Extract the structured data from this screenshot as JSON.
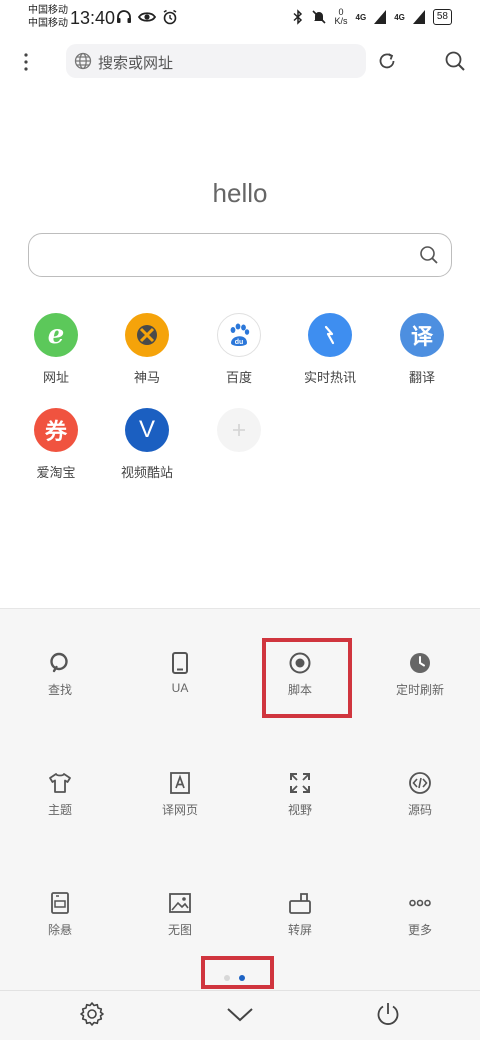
{
  "status_bar": {
    "carrier_1": "中国移动",
    "carrier_2": "中国移动",
    "time": "13:40",
    "net_speed_value": "0",
    "net_speed_unit": "K/s",
    "signal_1": "4G",
    "signal_2": "4G",
    "battery": "58"
  },
  "toolbar": {
    "address_placeholder": "搜索或网址"
  },
  "home": {
    "greeting": "hello",
    "search_placeholder": "",
    "shortcuts": [
      {
        "label": "网址",
        "glyph": "e",
        "color": "#5cc85a"
      },
      {
        "label": "神马",
        "glyph": "",
        "color": "#f5a30a"
      },
      {
        "label": "百度",
        "glyph": "du",
        "color": "#ffffff"
      },
      {
        "label": "实时热讯",
        "glyph": "",
        "color": "#3e8ef0"
      },
      {
        "label": "翻译",
        "glyph": "译",
        "color": "#4d8fe0"
      },
      {
        "label": "爱淘宝",
        "glyph": "券",
        "color": "#f0533f"
      },
      {
        "label": "视频酷站",
        "glyph": "V",
        "color": "#1b5fc1"
      }
    ]
  },
  "menu": {
    "items": [
      {
        "label": "查找",
        "icon": "search-icon"
      },
      {
        "label": "UA",
        "icon": "phone-icon"
      },
      {
        "label": "脚本",
        "icon": "record-icon"
      },
      {
        "label": "定时刷新",
        "icon": "clock-icon"
      },
      {
        "label": "主题",
        "icon": "shirt-icon"
      },
      {
        "label": "译网页",
        "icon": "translate-page-icon"
      },
      {
        "label": "视野",
        "icon": "expand-icon"
      },
      {
        "label": "源码",
        "icon": "code-icon"
      },
      {
        "label": "除悬",
        "icon": "remove-float-icon"
      },
      {
        "label": "无图",
        "icon": "no-image-icon"
      },
      {
        "label": "转屏",
        "icon": "rotate-screen-icon"
      },
      {
        "label": "更多",
        "icon": "more-icon"
      }
    ],
    "page_count": 2,
    "active_page": 2,
    "highlight_color": "#d0353e"
  }
}
